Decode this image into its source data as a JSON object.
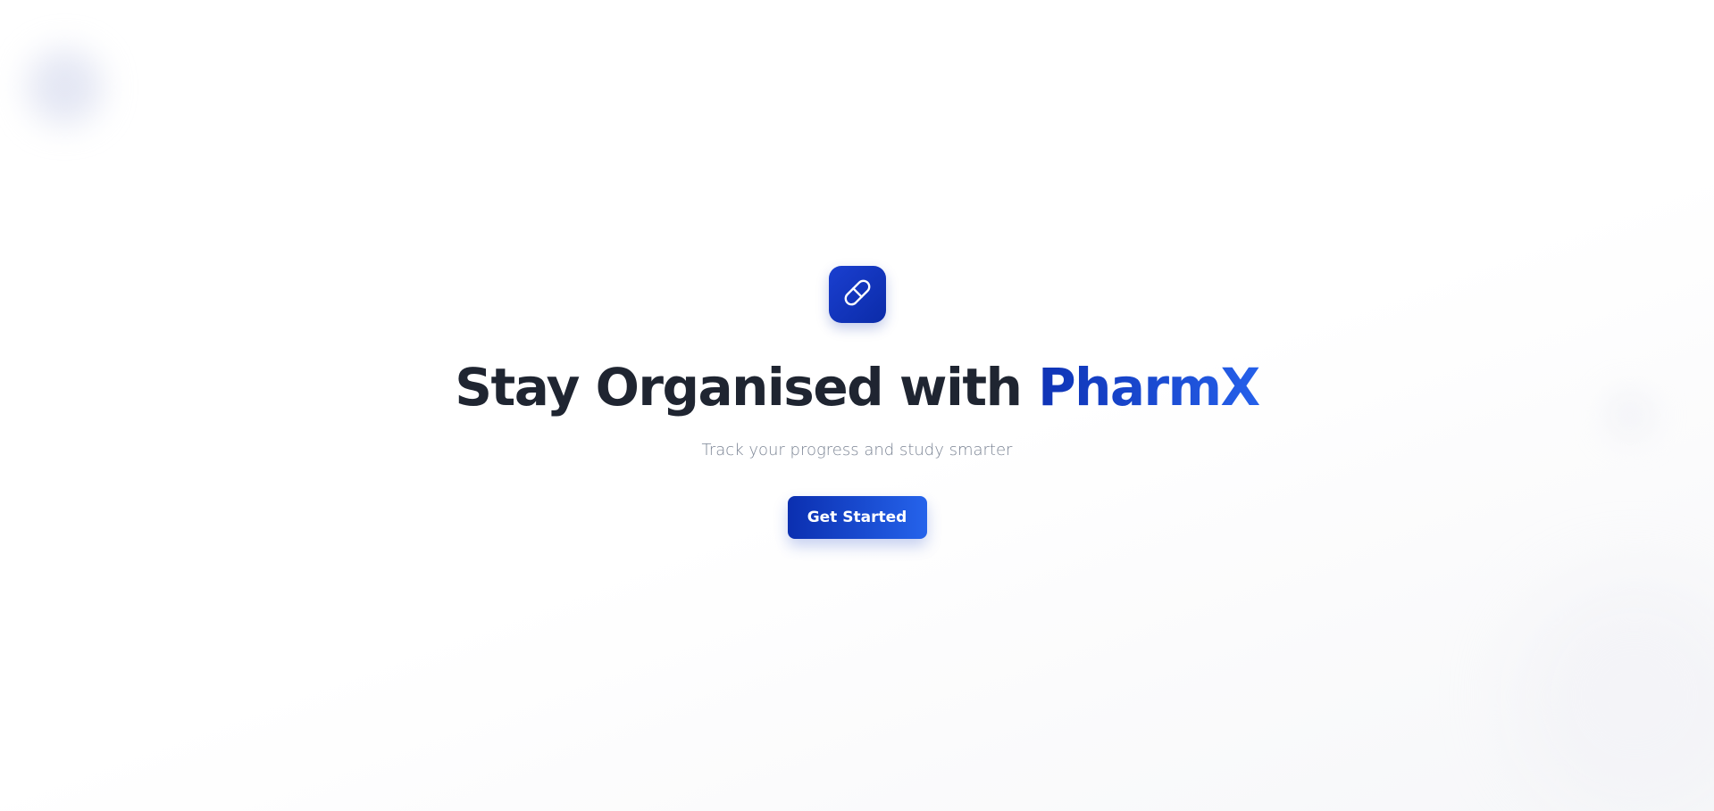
{
  "hero": {
    "logo_icon": "pill-icon",
    "headline_prefix": "Stay Organised with",
    "headline_brand": "PharmX",
    "subtitle": "Track your progress and study smarter",
    "cta_label": "Get Started"
  },
  "colors": {
    "accent": "#1a3fd0",
    "accent_light": "#2563eb",
    "heading": "#1f2531",
    "subtitle": "#7b8494",
    "background": "#ffffff"
  }
}
